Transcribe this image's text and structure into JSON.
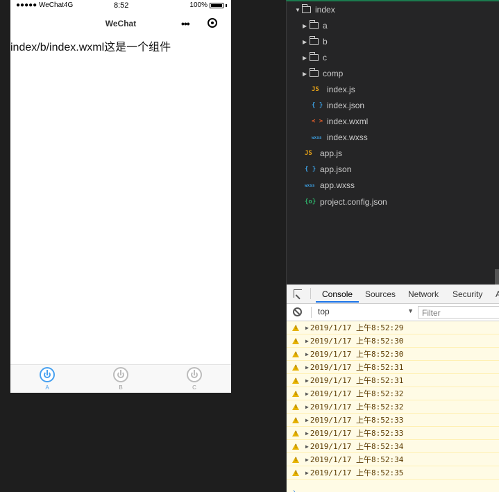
{
  "phone": {
    "status_left": "●●●●● WeChat4G",
    "status_time": "8:52",
    "status_battery": "100%",
    "nav_title": "WeChat",
    "nav_more": "•••",
    "content_text": "index/b/index.wxml这是一个组件",
    "tabs": [
      {
        "label": "A",
        "active": true
      },
      {
        "label": "B",
        "active": false
      },
      {
        "label": "C",
        "active": false
      }
    ],
    "accent_color": "#46a0f0"
  },
  "file_tree": {
    "root": "index",
    "folders": [
      "a",
      "b",
      "c",
      "comp"
    ],
    "index_files": [
      {
        "name": "index.js",
        "icon": "JS",
        "color": "#e8a317"
      },
      {
        "name": "index.json",
        "icon": "{ }",
        "color": "#3c9ee0"
      },
      {
        "name": "index.wxml",
        "icon": "< >",
        "color": "#e8602c"
      },
      {
        "name": "index.wxss",
        "icon": "wxss",
        "color": "#3c9ee0"
      }
    ],
    "root_files": [
      {
        "name": "app.js",
        "icon": "JS",
        "color": "#e8a317"
      },
      {
        "name": "app.json",
        "icon": "{ }",
        "color": "#3c9ee0"
      },
      {
        "name": "app.wxss",
        "icon": "wxss",
        "color": "#3c9ee0"
      },
      {
        "name": "project.config.json",
        "icon": "{o}",
        "color": "#2fb36b"
      }
    ]
  },
  "devtools": {
    "tabs": [
      "Console",
      "Sources",
      "Network",
      "Security",
      "A"
    ],
    "active_tab": "Console",
    "context": "top",
    "filter_placeholder": "Filter",
    "logs": [
      "2019/1/17 上午8:52:29",
      "2019/1/17 上午8:52:30",
      "2019/1/17 上午8:52:30",
      "2019/1/17 上午8:52:31",
      "2019/1/17 上午8:52:31",
      "2019/1/17 上午8:52:32",
      "2019/1/17 上午8:52:32",
      "2019/1/17 上午8:52:33",
      "2019/1/17 上午8:52:33",
      "2019/1/17 上午8:52:34",
      "2019/1/17 上午8:52:34",
      "2019/1/17 上午8:52:35"
    ],
    "prompt": "›"
  }
}
